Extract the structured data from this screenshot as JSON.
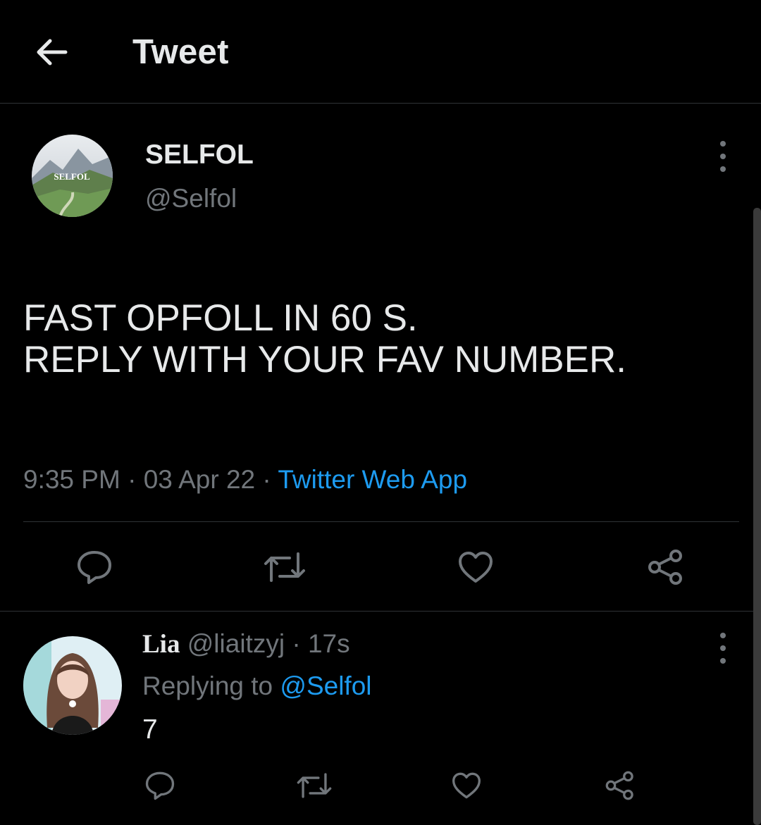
{
  "header": {
    "title": "Tweet",
    "back_icon": "arrow-left-icon"
  },
  "tweet": {
    "avatar_text": "SELFOL",
    "name": "SELFOL",
    "handle": "@Selfol",
    "text_lines": [
      "FAST OPFOLL IN 60 S.",
      "REPLY WITH YOUR FAV NUMBER."
    ],
    "time": "9:35 PM",
    "date": "03 Apr 22",
    "separator": " · ",
    "source": "Twitter Web App",
    "actions": [
      "reply-icon",
      "retweet-icon",
      "like-icon",
      "share-icon"
    ]
  },
  "reply": {
    "name": "Lia",
    "handle": "@liaitzyj",
    "time": "17s",
    "separator": " · ",
    "replying_prefix": "Replying to ",
    "replying_to": "@Selfol",
    "text": "7",
    "actions": [
      "reply-icon",
      "retweet-icon",
      "like-icon",
      "share-icon"
    ]
  },
  "colors": {
    "background": "#000000",
    "text": "#e7e9ea",
    "muted": "#71767b",
    "accent": "#1d9bf0",
    "divider": "#2f3336"
  }
}
